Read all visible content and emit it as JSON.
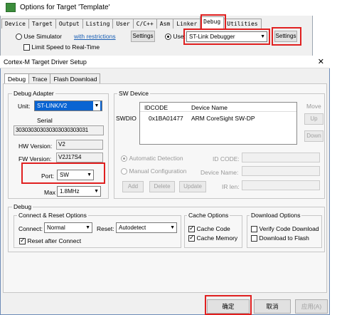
{
  "bg_window": {
    "title": "Options for Target 'Template'",
    "tabs": [
      "Device",
      "Target",
      "Output",
      "Listing",
      "User",
      "C/C++",
      "Asm",
      "Linker",
      "Debug",
      "Utilities"
    ],
    "use_simulator_label": "Use Simulator",
    "with_restrictions_link": "with restrictions",
    "settings_left_label": "Settings",
    "limit_speed_label": "Limit Speed to Real-Time",
    "use_label": "Use:",
    "debugger_value": "ST-Link Debugger",
    "settings_right_label": "Settings"
  },
  "dialog": {
    "title": "Cortex-M Target Driver Setup",
    "close_glyph": "✕",
    "tabs": [
      "Debug",
      "Trace",
      "Flash Download"
    ],
    "debug_adapter": {
      "group_label": "Debug Adapter",
      "unit_label": "Unit:",
      "unit_value": "ST-LINK/V2",
      "serial_label": "Serial",
      "serial_value": "303030303030303030303031",
      "hw_version_label": "HW Version:",
      "hw_version_value": "V2",
      "fw_version_label": "FW Version:",
      "fw_version_value": "V2J17S4",
      "port_label": "Port:",
      "port_value": "SW",
      "max_label": "Max",
      "max_value": "1.8MHz"
    },
    "sw_device": {
      "group_label": "SW Device",
      "col_idcode": "IDCODE",
      "col_device_name": "Device Name",
      "row_label": "SWDIO",
      "row_idcode": "0x1BA01477",
      "row_device_name": "ARM CoreSight SW-DP",
      "move_label": "Move",
      "up_label": "Up",
      "down_label": "Down",
      "auto_detect_label": "Automatic Detection",
      "manual_config_label": "Manual Configuration",
      "id_code_label": "ID CODE:",
      "device_name_label": "Device Name:",
      "ir_len_label": "IR len:",
      "add_label": "Add",
      "delete_label": "Delete",
      "update_label": "Update"
    },
    "debug": {
      "group_label": "Debug",
      "connect_reset": {
        "group_label": "Connect & Reset Options",
        "connect_label": "Connect:",
        "connect_value": "Normal",
        "reset_label": "Reset:",
        "reset_value": "Autodetect",
        "reset_after_connect_label": "Reset after Connect"
      },
      "cache": {
        "group_label": "Cache Options",
        "cache_code_label": "Cache Code",
        "cache_memory_label": "Cache Memory"
      },
      "download": {
        "group_label": "Download Options",
        "verify_label": "Verify Code Download",
        "download_to_flash_label": "Download to Flash"
      }
    },
    "footer": {
      "ok_label": "确定",
      "cancel_label": "取消",
      "apply_label": "应用(A)"
    }
  }
}
